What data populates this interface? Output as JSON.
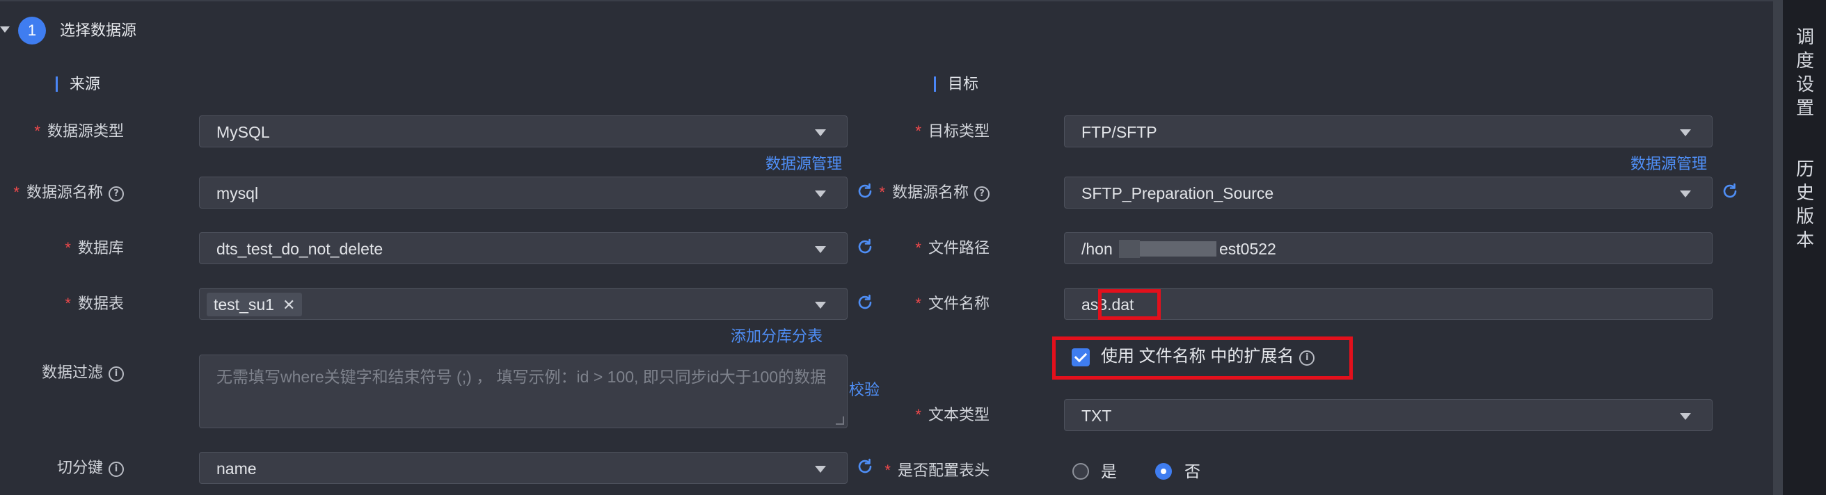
{
  "step": {
    "number": "1",
    "title": "选择数据源"
  },
  "source": {
    "section_title": "来源",
    "datasource_type": {
      "label": "数据源类型",
      "value": "MySQL"
    },
    "manage_link": "数据源管理",
    "datasource_name": {
      "label": "数据源名称",
      "value": "mysql"
    },
    "database": {
      "label": "数据库",
      "value": "dts_test_do_not_delete"
    },
    "table": {
      "label": "数据表",
      "tag": "test_su1",
      "tag_close": "✕"
    },
    "add_sharding_link": "添加分库分表",
    "filter": {
      "label": "数据过滤",
      "placeholder": "无需填写where关键字和结束符号 (;) ，  填写示例：id > 100, 即只同步id大于100的数据"
    },
    "validate_link": "校验",
    "split_key": {
      "label": "切分键",
      "value": "name"
    }
  },
  "target": {
    "section_title": "目标",
    "target_type": {
      "label": "目标类型",
      "value": "FTP/SFTP"
    },
    "manage_link": "数据源管理",
    "datasource_name": {
      "label": "数据源名称",
      "value": "SFTP_Preparation_Source"
    },
    "file_path": {
      "label": "文件路径",
      "value_start": "/hon",
      "value_end": "est0522"
    },
    "file_name": {
      "label": "文件名称",
      "value": "as3.dat"
    },
    "use_extension": {
      "label": "使用 文件名称 中的扩展名",
      "checked": true
    },
    "text_type": {
      "label": "文本类型",
      "value": "TXT"
    },
    "header": {
      "label": "是否配置表头",
      "options": [
        "是",
        "否"
      ],
      "selected": "否"
    }
  },
  "side_tabs": [
    "调度设置",
    "历史版本"
  ],
  "colors": {
    "accent": "#3f7df0",
    "required": "#f0494b",
    "highlight": "#e3101c",
    "link": "#4f8ff7"
  }
}
